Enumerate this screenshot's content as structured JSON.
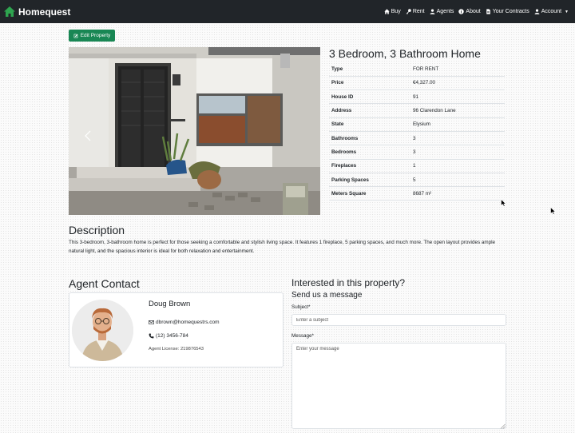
{
  "navbar": {
    "brand": "Homequest",
    "links": [
      {
        "label": "Buy",
        "icon": "home-icon"
      },
      {
        "label": "Rent",
        "icon": "key-icon"
      },
      {
        "label": "Agents",
        "icon": "user-icon"
      },
      {
        "label": "About",
        "icon": "info-icon"
      },
      {
        "label": "Your Contracts",
        "icon": "file-icon"
      },
      {
        "label": "Account",
        "icon": "user-icon"
      }
    ]
  },
  "edit_button": "Edit Property",
  "property": {
    "title": "3 Bedroom, 3 Bathroom Home",
    "details": [
      {
        "key": "Type",
        "value": "FOR RENT"
      },
      {
        "key": "Price",
        "value": "€4,327.00"
      },
      {
        "key": "House ID",
        "value": "91"
      },
      {
        "key": "Address",
        "value": "96 Clarendon Lane"
      },
      {
        "key": "State",
        "value": "Elysium"
      },
      {
        "key": "Bathrooms",
        "value": "3"
      },
      {
        "key": "Bedrooms",
        "value": "3"
      },
      {
        "key": "Fireplaces",
        "value": "1"
      },
      {
        "key": "Parking Spaces",
        "value": "5"
      },
      {
        "key": "Meters Square",
        "value": "8687 m²"
      }
    ]
  },
  "description": {
    "heading": "Description",
    "text": "This 3-bedroom, 3-bathroom home is perfect for those seeking a comfortable and stylish living space. It features 1 fireplace, 5 parking spaces, and much more. The open layout provides ample natural light, and the spacious interior is ideal for both relaxation and entertainment."
  },
  "agent": {
    "heading": "Agent Contact",
    "name": "Doug Brown",
    "email": "dbrown@homequestrs.com",
    "phone": "(12) 3456-784",
    "license": "Agent License: 219876543"
  },
  "contact_form": {
    "heading": "Interested in this property?",
    "subheading": "Send us a message",
    "subject_label": "Subject*",
    "subject_placeholder": "Enter a subject",
    "message_label": "Message*",
    "message_placeholder": "Enter your message"
  }
}
